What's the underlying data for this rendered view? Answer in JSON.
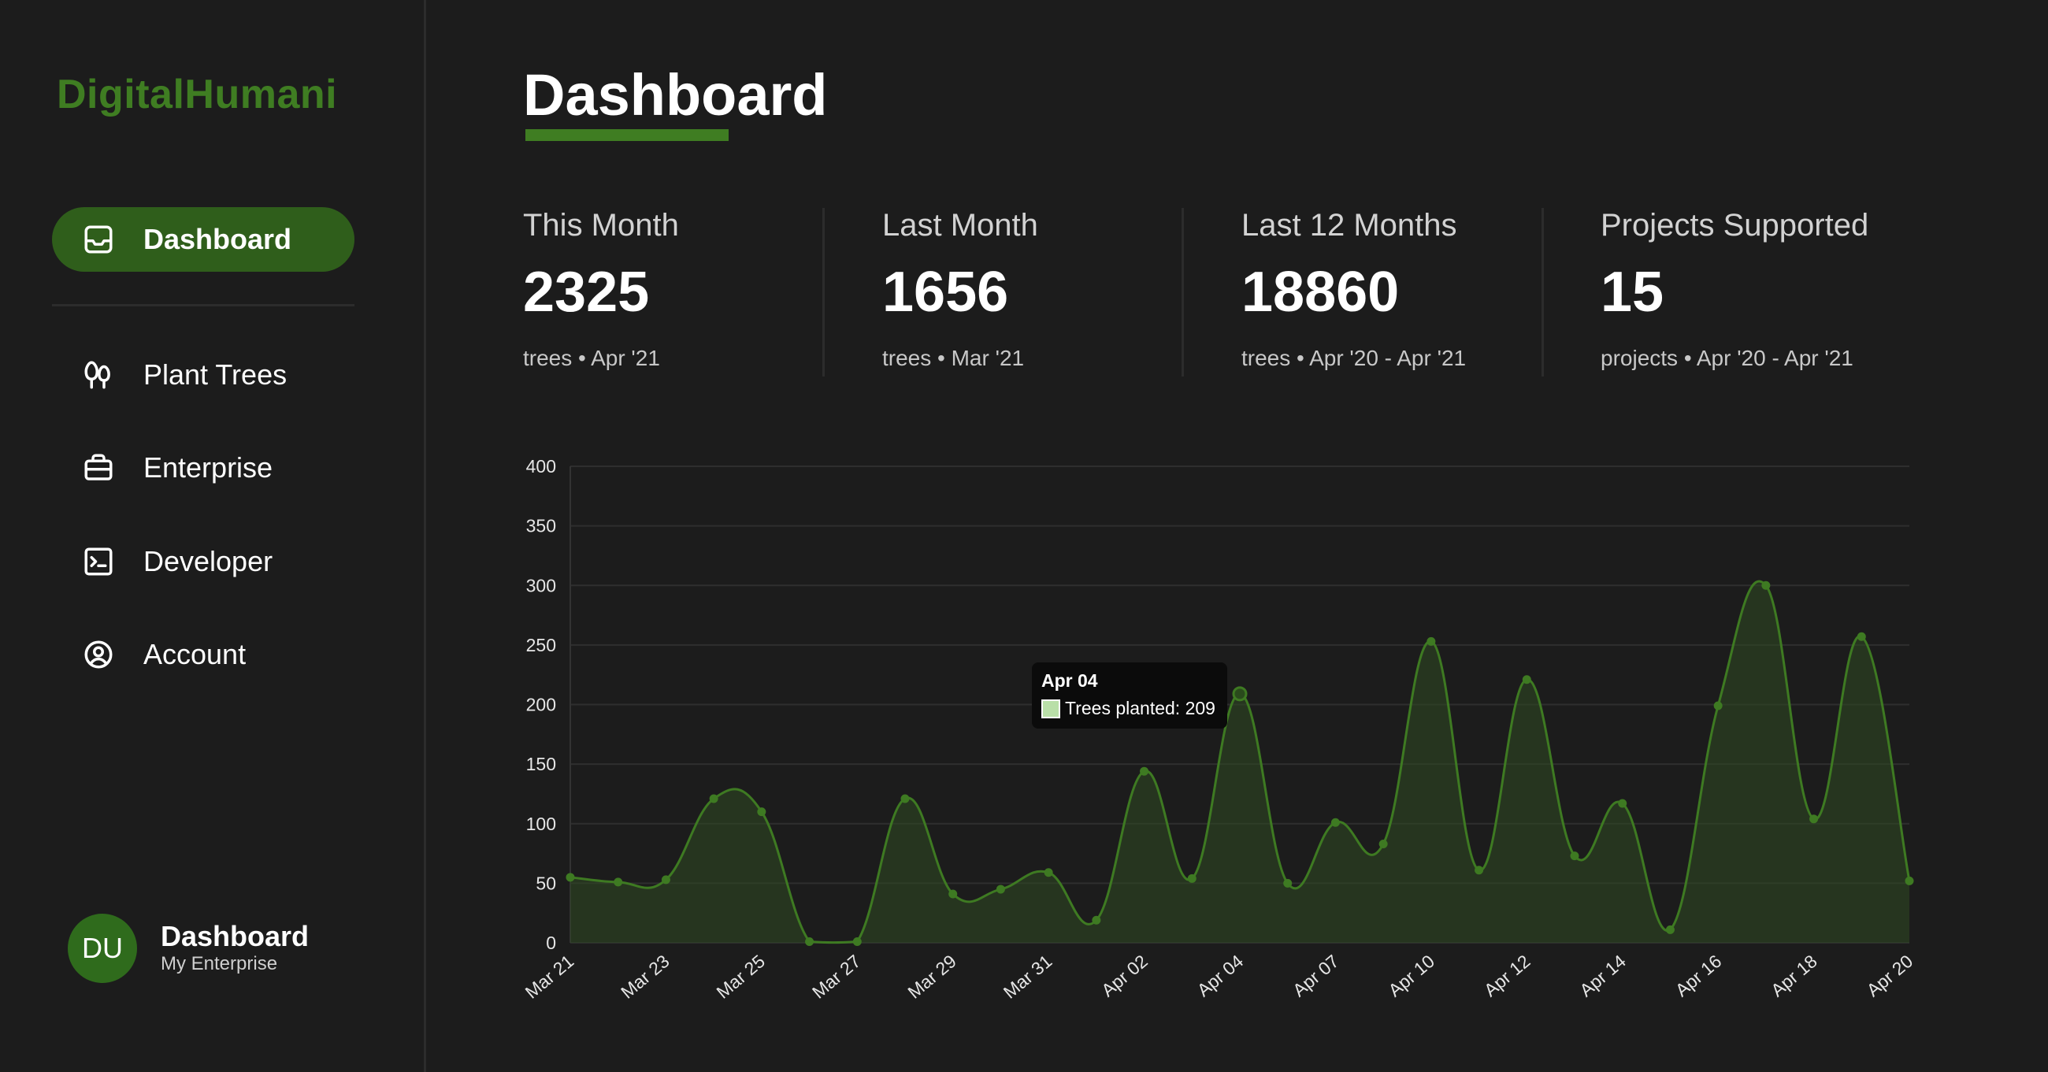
{
  "app": {
    "brand": "DigitalHumani"
  },
  "sidebar": {
    "items": [
      {
        "label": "Dashboard",
        "icon": "inbox-icon",
        "active": true
      },
      {
        "label": "Plant Trees",
        "icon": "trees-icon",
        "active": false
      },
      {
        "label": "Enterprise",
        "icon": "briefcase-icon",
        "active": false
      },
      {
        "label": "Developer",
        "icon": "terminal-icon",
        "active": false
      },
      {
        "label": "Account",
        "icon": "user-circle-icon",
        "active": false
      }
    ],
    "user": {
      "initials": "DU",
      "name": "Dashboard",
      "org": "My Enterprise"
    }
  },
  "page": {
    "title": "Dashboard"
  },
  "stats": [
    {
      "label": "This Month",
      "value": "2325",
      "sub": "trees • Apr '21"
    },
    {
      "label": "Last Month",
      "value": "1656",
      "sub": "trees • Mar '21"
    },
    {
      "label": "Last 12 Months",
      "value": "18860",
      "sub": "trees • Apr '20 - Apr '21"
    },
    {
      "label": "Projects Supported",
      "value": "15",
      "sub": "projects • Apr '20 - Apr '21"
    }
  ],
  "colors": {
    "accent": "#3f7d22",
    "active_bg": "#2f5e1b",
    "background": "#1c1c1c",
    "line": "#3e7a22",
    "area": "#2f4a22"
  },
  "chart_data": {
    "type": "area",
    "x_labels": [
      "Mar 21",
      "Mar 23",
      "Mar 25",
      "Mar 27",
      "Mar 29",
      "Mar 31",
      "Apr 02",
      "Apr 04",
      "Apr 07",
      "Apr 10",
      "Apr 12",
      "Apr 14",
      "Apr 16",
      "Apr 18",
      "Apr 20"
    ],
    "series": [
      {
        "name": "Trees planted",
        "values": [
          55,
          51,
          53,
          121,
          110,
          1,
          1,
          121,
          41,
          45,
          59,
          19,
          144,
          54,
          209,
          50,
          101,
          83,
          253,
          61,
          221,
          73,
          117,
          11,
          199,
          300,
          104,
          257,
          52
        ]
      }
    ],
    "ylim": [
      0,
      400
    ],
    "yticks": [
      0,
      50,
      100,
      150,
      200,
      250,
      300,
      350,
      400
    ],
    "grid": true,
    "legend": "none",
    "tooltip": {
      "title": "Apr 04",
      "label": "Trees planted: 209",
      "index": 14
    }
  }
}
